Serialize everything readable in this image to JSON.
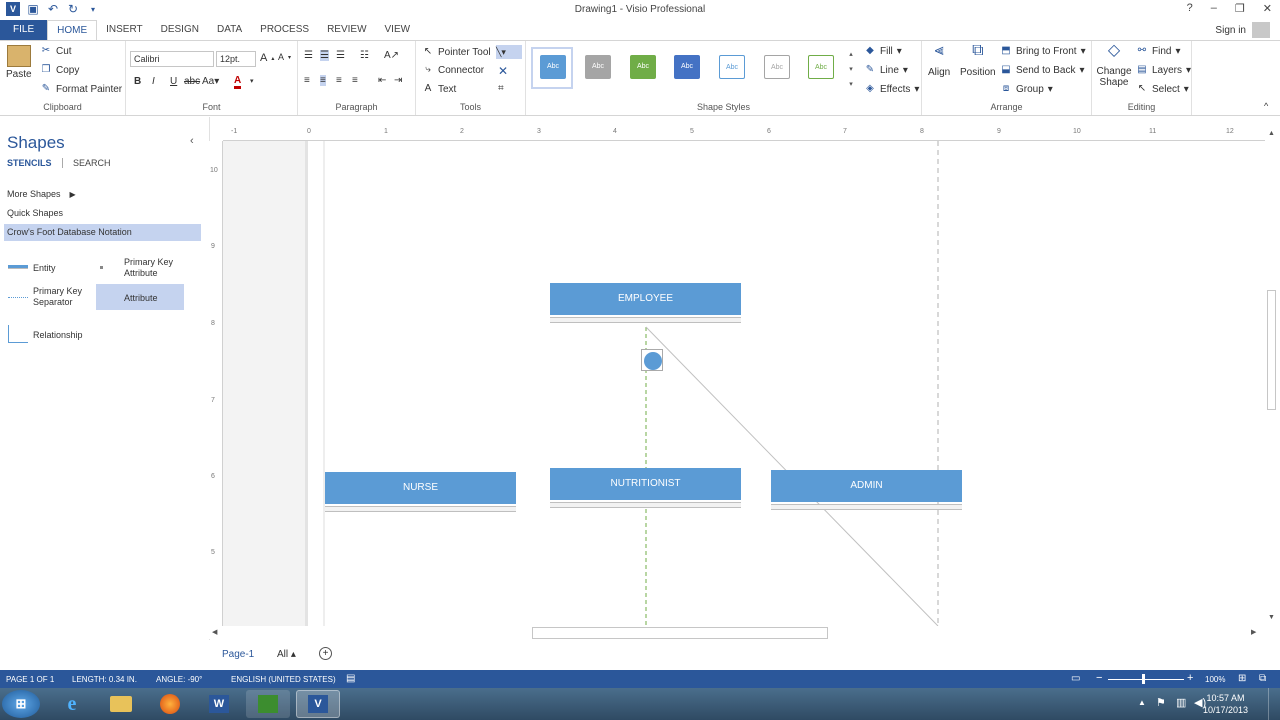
{
  "app": {
    "title": "Drawing1 - Visio Professional"
  },
  "window_controls": {
    "help": "?",
    "minimize": "–",
    "restore": "❐",
    "close": "✕"
  },
  "tabs": [
    {
      "label": "FILE"
    },
    {
      "label": "HOME"
    },
    {
      "label": "INSERT"
    },
    {
      "label": "DESIGN"
    },
    {
      "label": "DATA"
    },
    {
      "label": "PROCESS"
    },
    {
      "label": "REVIEW"
    },
    {
      "label": "VIEW"
    }
  ],
  "account": {
    "signin": "Sign in"
  },
  "ribbon": {
    "clipboard": {
      "label": "Clipboard",
      "paste": "Paste",
      "cut": "Cut",
      "copy": "Copy",
      "format_painter": "Format Painter"
    },
    "font": {
      "label": "Font",
      "family": "Calibri",
      "size": "12pt."
    },
    "paragraph": {
      "label": "Paragraph"
    },
    "tools": {
      "label": "Tools",
      "pointer": "Pointer Tool",
      "connector": "Connector",
      "text": "Text"
    },
    "shape_styles": {
      "label": "Shape Styles",
      "swatch_text": "Abc",
      "swatches": [
        {
          "bg": "#5b9bd5",
          "fg": "#ffffff"
        },
        {
          "bg": "#a5a5a5",
          "fg": "#ffffff"
        },
        {
          "bg": "#70ad47",
          "fg": "#ffffff"
        },
        {
          "bg": "#4472c4",
          "fg": "#ffffff"
        },
        {
          "bg": "#ffffff",
          "fg": "#5b9bd5"
        },
        {
          "bg": "#ffffff",
          "fg": "#a5a5a5"
        },
        {
          "bg": "#ffffff",
          "fg": "#70ad47"
        }
      ],
      "fill": "Fill",
      "line": "Line",
      "effects": "Effects"
    },
    "arrange": {
      "label": "Arrange",
      "align": "Align",
      "position": "Position",
      "bring_to_front": "Bring to Front",
      "send_to_back": "Send to Back",
      "group": "Group"
    },
    "editing": {
      "label": "Editing",
      "change_shape": "Change Shape",
      "find": "Find",
      "layers": "Layers",
      "select": "Select"
    }
  },
  "shapes_pane": {
    "title": "Shapes",
    "tab_stencils": "STENCILS",
    "tab_search": "SEARCH",
    "more_shapes": "More Shapes",
    "quick_shapes": "Quick Shapes",
    "stencil": "Crow's Foot Database Notation",
    "items": [
      "Entity",
      "Primary Key Attribute",
      "Primary Key Separator",
      "Attribute",
      "Relationship"
    ]
  },
  "ruler": {
    "top": [
      "-1",
      "0",
      "1",
      "2",
      "3",
      "4",
      "5",
      "6",
      "7",
      "8",
      "9",
      "10",
      "11",
      "12"
    ],
    "left": [
      "10",
      "9",
      "8",
      "7",
      "6",
      "5"
    ]
  },
  "diagram": {
    "entities": [
      "EMPLOYEE",
      "NURSE",
      "NUTRITIONIST",
      "ADMIN"
    ],
    "accent": "#5b9bd5"
  },
  "page_tabs": {
    "page": "Page-1",
    "all": "All ▴",
    "add": "+"
  },
  "status": {
    "page": "PAGE 1 OF 1",
    "length": "LENGTH: 0.34 IN.",
    "angle": "ANGLE: -90°",
    "language": "ENGLISH (UNITED STATES)",
    "zoom": "100%"
  },
  "taskbar": {
    "time": "10:57 AM",
    "date": "10/17/2013"
  }
}
